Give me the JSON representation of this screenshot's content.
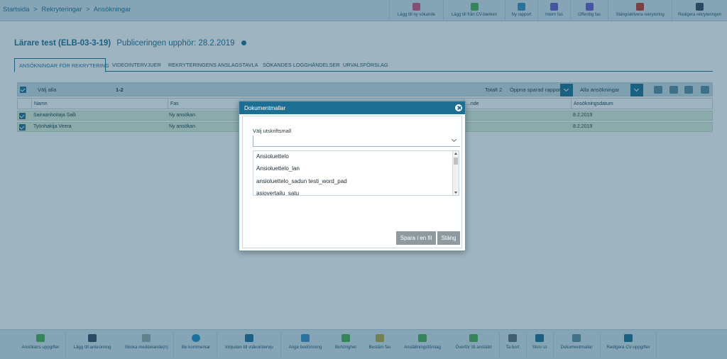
{
  "breadcrumb": [
    "Startsida",
    ">",
    "Rekryteringar",
    ">",
    "Ansökningar"
  ],
  "toolbar": {
    "buttons": [
      {
        "label": "Lägg till ny sökande",
        "icon": "add-person-icon",
        "color": "#d94f7a"
      },
      {
        "label": "Lägg till från CV-banken",
        "icon": "cv-bank-icon",
        "color": "#4caf50"
      },
      {
        "label": "Ny rapport",
        "icon": "report-icon",
        "color": "#3a8fc4"
      },
      {
        "label": "Intern fas",
        "icon": "flag-icon",
        "color": "#6a5acd"
      },
      {
        "label": "Offentlig fas",
        "icon": "public-flag-icon",
        "color": "#6a5acd"
      },
      {
        "label": "Stäng/aktivera rekrytering",
        "icon": "toggle-recruitment-icon",
        "color": "#c0392b"
      },
      {
        "label": "Redigera rekryteringen",
        "icon": "edit-icon",
        "color": "#34495e"
      }
    ]
  },
  "header": {
    "title": "Lärare test (ELB-03-3-19)",
    "publication": "Publiceringen upphör: 28.2.2019"
  },
  "tabs": [
    {
      "label": "ANSÖKNINGAR FÖR REKRYTERING",
      "active": true
    },
    {
      "label": "VIDEOINTERVJUER",
      "active": false
    },
    {
      "label": "REKRYTERINGENS ANSLAGSTAVLA",
      "active": false
    },
    {
      "label": "SÖKANDES LOGGHÄNDELSER",
      "active": false
    },
    {
      "label": "URVALSFÖRSLAG",
      "active": false
    }
  ],
  "grid": {
    "select_all": "Välj alla",
    "range": "1-2",
    "total": "Totalt 2",
    "saved_report": "Öppna sparad rapport",
    "filter": "Alla ansökningar",
    "columns": [
      "Namn",
      "Fas",
      "...nde",
      "Ansökningsdatum"
    ],
    "rows": [
      {
        "name": "Sairaanhoitaja Salli",
        "phase": "Ny ansökan",
        "date": "8.2.2019"
      },
      {
        "name": "Työnhakija Veera",
        "phase": "Ny ansökan",
        "date": "8.2.2019"
      }
    ]
  },
  "dialog": {
    "title": "Dokumentmallar",
    "label": "Välj utskriftsmall",
    "select_value": "",
    "options": [
      "Ansioluettelo",
      "Ansioluettelo_lan",
      "ansioluettelo_sadun testi_word_pad",
      "asiovertailu_satu"
    ],
    "save_button": "Spara i en fil",
    "close_button": "Stäng"
  },
  "bottombar": {
    "buttons": [
      {
        "label": "Ansökans uppgifter",
        "icon": "application-details-icon",
        "color": "#4caf50"
      },
      {
        "label": "Lägg till anteckning",
        "icon": "note-icon",
        "color": "#34495e"
      },
      {
        "label": "Skicka meddelande(n)",
        "icon": "envelope-icon",
        "color": "#95a5a6"
      },
      {
        "label": "Be kommentar",
        "icon": "comment-icon",
        "color": "#1c8fc4"
      },
      {
        "label": "Inbjudan till videointervju",
        "icon": "video-icon",
        "color": "#1c6f93"
      },
      {
        "label": "Ange bedömning",
        "icon": "rating-icon",
        "color": "#3a8fc4"
      },
      {
        "label": "Behörighet",
        "icon": "eligibility-icon",
        "color": "#4caf50"
      },
      {
        "label": "Bestäm fas",
        "icon": "phase-icon",
        "color": "#b5a642"
      },
      {
        "label": "Anställningsförslag",
        "icon": "hire-proposal-icon",
        "color": "#4caf50"
      },
      {
        "label": "Överför till anställd",
        "icon": "transfer-icon",
        "color": "#4caf50"
      },
      {
        "label": "Ta bort",
        "icon": "trash-icon",
        "color": "#5f6b70"
      },
      {
        "label": "Skriv ut",
        "icon": "print-icon",
        "color": "#1c6f93"
      },
      {
        "label": "Dokumentmallar",
        "icon": "document-templates-icon",
        "color": "#5f8aa0"
      },
      {
        "label": "Redigera CV-uppgifter",
        "icon": "edit-cv-icon",
        "color": "#1c6f93"
      }
    ]
  }
}
